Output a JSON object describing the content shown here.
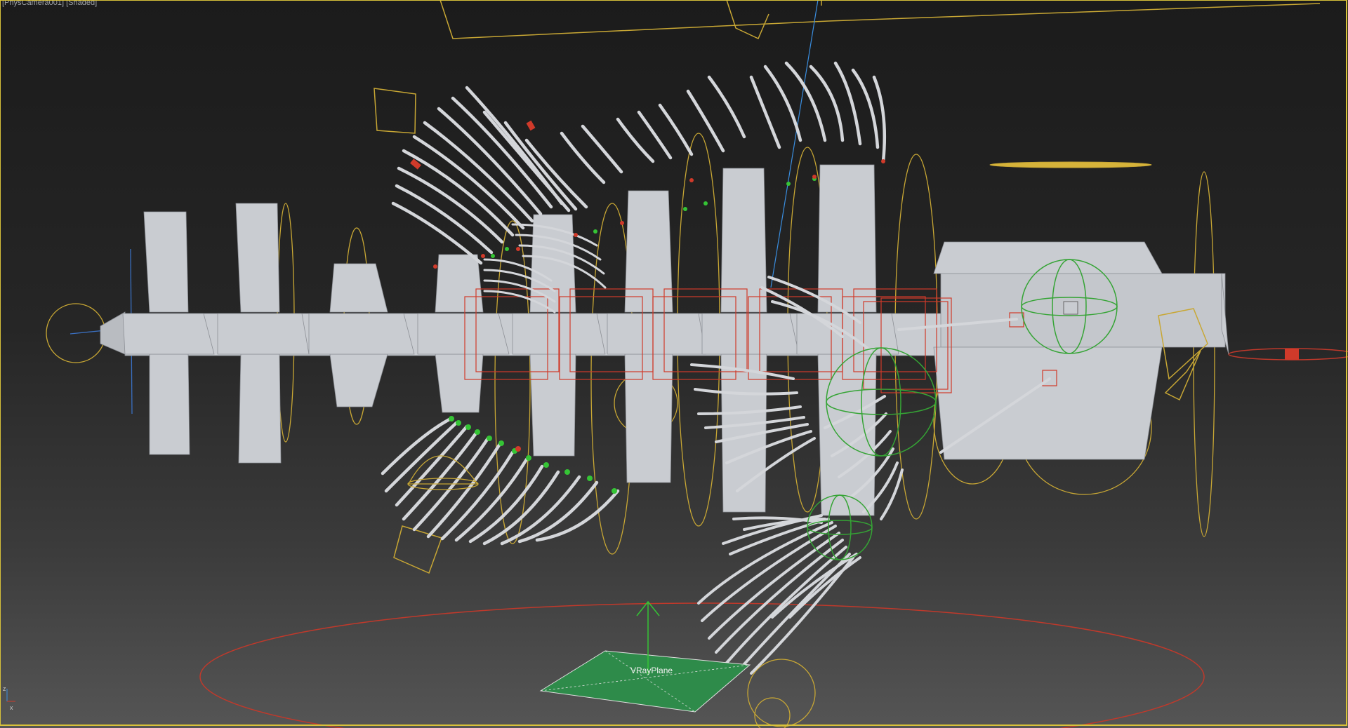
{
  "viewport": {
    "label": "[PhysCamera001] [Shaded]",
    "active_border_color": "#d8c23a"
  },
  "scene": {
    "objects": {
      "vray_plane_label": "VRayPlane"
    },
    "colors": {
      "geometry": "#c9ccd1",
      "helper": "#c8a734",
      "selection": "#d03a2a",
      "light_gizmo": "#35a435",
      "vray_plane": "#2e8b4a",
      "camera_target": "#3a8ee0"
    }
  },
  "axis_tripod": {
    "x": "x",
    "z": "z"
  }
}
